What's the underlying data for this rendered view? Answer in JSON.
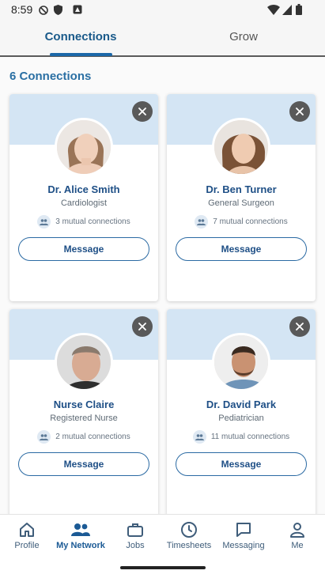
{
  "status": {
    "time": "8:59"
  },
  "tabs": [
    {
      "label": "Connections",
      "active": true
    },
    {
      "label": "Grow",
      "active": false
    }
  ],
  "section_title": "6 Connections",
  "cards": [
    {
      "name": "Dr. Alice Smith",
      "role": "Cardiologist",
      "mutual": "3 mutual connections",
      "button": "Message"
    },
    {
      "name": "Dr. Ben Turner",
      "role": "General Surgeon",
      "mutual": "7 mutual connections",
      "button": "Message"
    },
    {
      "name": "Nurse Claire",
      "role": "Registered Nurse",
      "mutual": "2 mutual connections",
      "button": "Message"
    },
    {
      "name": "Dr. David Park",
      "role": "Pediatrician",
      "mutual": "11 mutual connections",
      "button": "Message"
    }
  ],
  "bottom_nav": [
    {
      "label": "Profile",
      "icon": "home-icon",
      "active": false
    },
    {
      "label": "My Network",
      "icon": "people-icon",
      "active": true
    },
    {
      "label": "Jobs",
      "icon": "briefcase-icon",
      "active": false
    },
    {
      "label": "Timesheets",
      "icon": "clock-icon",
      "active": false
    },
    {
      "label": "Messaging",
      "icon": "chat-icon",
      "active": false
    },
    {
      "label": "Me",
      "icon": "person-icon",
      "active": false
    }
  ],
  "colors": {
    "accent": "#1b67a8",
    "banner": "#d4e5f4",
    "name": "#1e4f86"
  }
}
